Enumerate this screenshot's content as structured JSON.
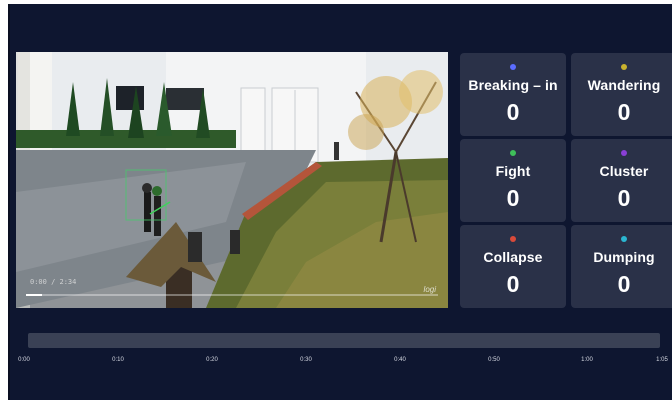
{
  "video": {
    "timestamp": "0:00 / 2:34",
    "logo_text": "logi",
    "progress": 0.04
  },
  "events": [
    {
      "label": "Breaking – in",
      "count": "0",
      "color": "#5b6cff"
    },
    {
      "label": "Wandering",
      "count": "0",
      "color": "#c9b22e"
    },
    {
      "label": "Fight",
      "count": "0",
      "color": "#3fbf5a"
    },
    {
      "label": "Cluster",
      "count": "0",
      "color": "#8a3fd6"
    },
    {
      "label": "Collapse",
      "count": "0",
      "color": "#d94a3a"
    },
    {
      "label": "Dumping",
      "count": "0",
      "color": "#2bb6d1"
    }
  ],
  "timeline": {
    "ticks": [
      "0:00",
      "0:10",
      "0:20",
      "0:30",
      "0:40",
      "0:50",
      "1:00",
      "1:05"
    ]
  }
}
